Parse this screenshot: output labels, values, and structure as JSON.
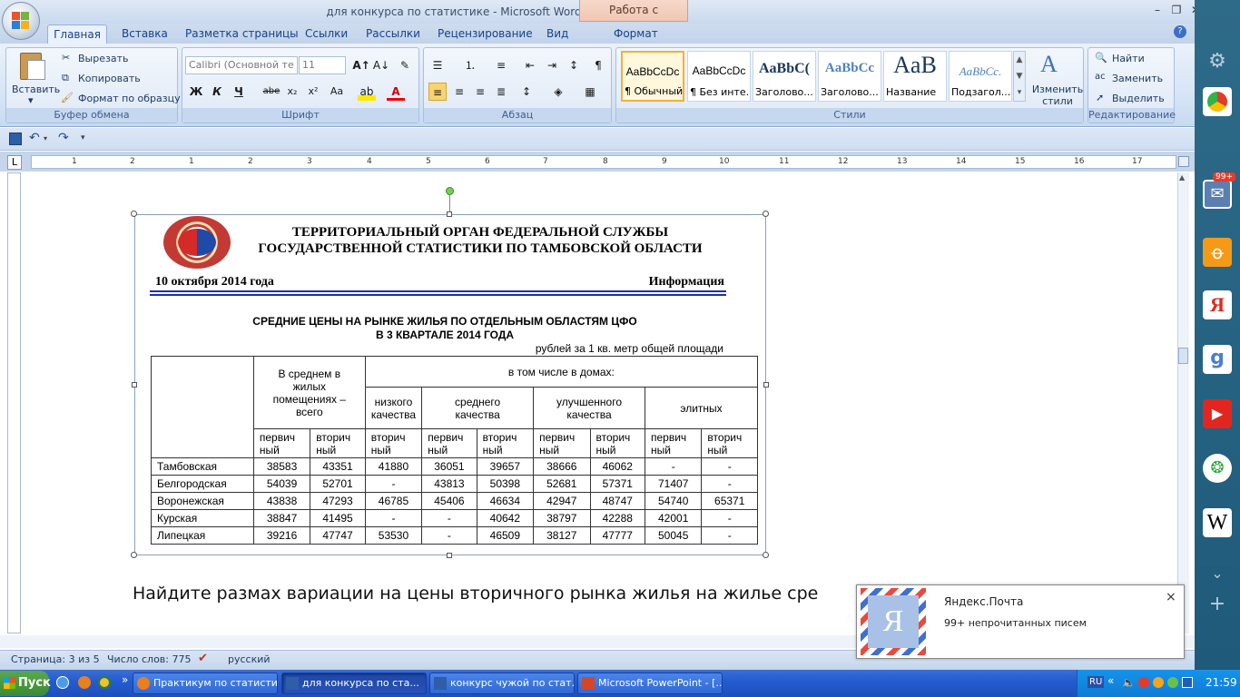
{
  "window": {
    "title": "для конкурса по статистике - Microsoft Word",
    "context_tab_header": "Работа с рисунками"
  },
  "tabs": [
    "Главная",
    "Вставка",
    "Разметка страницы",
    "Ссылки",
    "Рассылки",
    "Рецензирование",
    "Вид",
    "Формат"
  ],
  "ribbon": {
    "clipboard": {
      "paste": "Вставить",
      "cut": "Вырезать",
      "copy": "Копировать",
      "format_painter": "Формат по образцу",
      "label": "Буфер обмена"
    },
    "font": {
      "family": "Calibri (Основной те",
      "size": "11",
      "label": "Шрифт",
      "bold": "Ж",
      "italic": "К",
      "underline": "Ч",
      "strike": "abe",
      "subscript": "x₂",
      "superscript": "x²",
      "change_case": "Aa"
    },
    "paragraph": {
      "label": "Абзац"
    },
    "styles": {
      "label": "Стили",
      "items": [
        {
          "preview": "AaBbCcDc",
          "name": "¶ Обычный"
        },
        {
          "preview": "AaBbCcDc",
          "name": "¶ Без инте..."
        },
        {
          "preview": "AaBbC(",
          "name": "Заголово..."
        },
        {
          "preview": "AaBbCc",
          "name": "Заголово..."
        },
        {
          "preview": "AaB",
          "name": "Название"
        },
        {
          "preview": "AaBbCc.",
          "name": "Подзагол..."
        }
      ],
      "change_styles": "Изменить стили"
    },
    "editing": {
      "find": "Найти",
      "replace": "Заменить",
      "select": "Выделить",
      "label": "Редактирование"
    }
  },
  "ruler": {
    "marks": [
      "1",
      "2",
      "1",
      "2",
      "3",
      "4",
      "5",
      "6",
      "7",
      "8",
      "9",
      "10",
      "11",
      "12",
      "13",
      "14",
      "15",
      "16",
      "17"
    ]
  },
  "document": {
    "org_heading_1": "ТЕРРИТОРИАЛЬНЫЙ ОРГАН ФЕДЕРАЛЬНОЙ СЛУЖБЫ",
    "org_heading_2": "ГОСУДАРСТВЕННОЙ СТАТИСТИКИ ПО ТАМБОВСКОЙ ОБЛАСТИ",
    "date": "10 октября 2014 года",
    "info": "Информация",
    "subtitle_1": "СРЕДНИЕ ЦЕНЫ НА РЫНКЕ  ЖИЛЬЯ  ПО ОТДЕЛЬНЫМ ОБЛАСТЯМ ЦФО",
    "subtitle_2": "В 3  КВАРТАЛЕ 2014 ГОДА",
    "units": "рублей за 1 кв. метр общей площади",
    "table": {
      "h_avg": "В среднем в жилых помещениях – всего",
      "h_incl": "в том числе в домах:",
      "h_low": "низкого качества",
      "h_mid": "среднего качества",
      "h_imp": "улучшенного качества",
      "h_elite": "элитных",
      "sub_primary": "первич ный",
      "sub_secondary": "вторич ный",
      "rows": [
        {
          "region": "Тамбовская",
          "v": [
            "38583",
            "43351",
            "41880",
            "36051",
            "39657",
            "38666",
            "46062",
            "-",
            "-"
          ]
        },
        {
          "region": "Белгородская",
          "v": [
            "54039",
            "52701",
            "-",
            "43813",
            "50398",
            "52681",
            "57371",
            "71407",
            "-"
          ]
        },
        {
          "region": "Воронежская",
          "v": [
            "43838",
            "47293",
            "46785",
            "45406",
            "46634",
            "42947",
            "48747",
            "54740",
            "65371"
          ]
        },
        {
          "region": "Курская",
          "v": [
            "38847",
            "41495",
            "-",
            "-",
            "40642",
            "38797",
            "42288",
            "42001",
            "-"
          ]
        },
        {
          "region": "Липецкая",
          "v": [
            "39216",
            "47747",
            "53530",
            "-",
            "46509",
            "38127",
            "47777",
            "50045",
            "-"
          ]
        }
      ]
    },
    "question": "Найдите размах вариации на цены вторичного рынка жилья на жилье сре"
  },
  "status": {
    "page": "Страница: 3 из 5",
    "words": "Число слов: 775",
    "lang": "русский"
  },
  "notification": {
    "app": "Яндекс.Почта",
    "text": "99+ непрочитанных писем",
    "close": "×"
  },
  "sidebar": {
    "mail_badge": "99+"
  },
  "taskbar": {
    "start": "Пуск",
    "tasks": [
      "Практикум по статисти...",
      "для конкурса по ста...",
      "конкурс чужой по стат...",
      "Microsoft PowerPoint - [..."
    ],
    "lang": "RU",
    "time": "21:59"
  }
}
